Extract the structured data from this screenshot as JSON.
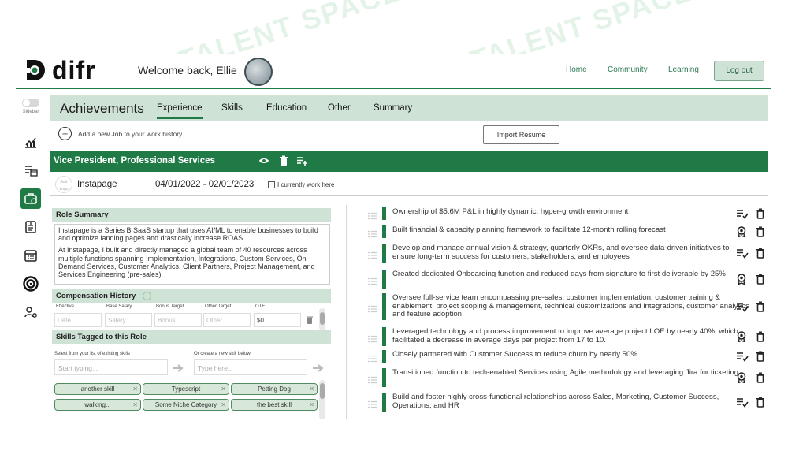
{
  "watermark": "AI TALENT SPACE",
  "header": {
    "logo_text": "difr",
    "welcome": "Welcome back, Ellie",
    "nav": [
      "Home",
      "Community",
      "Learning"
    ],
    "logout": "Log out"
  },
  "sidebar": {
    "toggle_label": "Sidebar",
    "icons": [
      "chart-icon",
      "list-calendar-icon",
      "briefcase-icon",
      "resume-icon",
      "calendar-icon",
      "target-icon",
      "user-settings-icon"
    ],
    "active_index": 2
  },
  "tabs": {
    "title": "Achievements",
    "items": [
      "Experience",
      "Skills",
      "Education",
      "Other",
      "Summary"
    ],
    "active": "Experience"
  },
  "add_job_text": "Add a new Job to your work history",
  "import_button": "Import Resume",
  "job": {
    "title": "Vice President, Professional Services",
    "add_logo": "Add Logo",
    "company": "Instapage",
    "dates": "04/01/2022 - 02/01/2023",
    "currently_work_here": "I currently work here"
  },
  "role_summary": {
    "header": "Role Summary",
    "paragraphs": [
      "Instapage is a Series B SaaS startup that uses AI/ML to enable businesses to build and optimize landing pages and drastically increase ROAS.",
      "At Instapage, I built and directly managed a global team of 40 resources across multiple functions spanning Implementation, Integrations, Custom Services, On-Demand Services, Customer Analytics, Client Partners, Project Management, and Services Engineering (pre-sales)"
    ]
  },
  "compensation": {
    "header": "Compensation History",
    "labels": [
      "Effective",
      "Base Salary",
      "Bonus Target",
      "Other Target",
      "OTE"
    ],
    "placeholders": [
      "Date",
      "Salary",
      "Bonus",
      "Other"
    ],
    "ote_value": "$0"
  },
  "skills": {
    "header": "Skills Tagged to this Role",
    "select_label": "Select from your list of existing skills",
    "create_label": "Or create a new skill below",
    "select_placeholder": "Start typing...",
    "create_placeholder": "Type here...",
    "chips": [
      "another skill",
      "Typescript",
      "Petting Dog",
      "walking...",
      "Some Niche Category",
      "the best skill"
    ]
  },
  "achievements": [
    {
      "text": "Ownership of $5.6M P&L in highly dynamic, hyper-growth environment",
      "icon": "checklist-icon"
    },
    {
      "text": "Built financial & capacity planning framework to facilitate 12-month rolling forecast",
      "icon": "award-icon"
    },
    {
      "text": "Develop and manage annual vision & strategy, quarterly OKRs, and oversee data-driven initiatives to ensure long-term success for customers, stakeholders, and employees",
      "icon": "checklist-icon"
    },
    {
      "text": "Created dedicated Onboarding function and reduced days from signature to first deliverable by 25%",
      "icon": "award-icon"
    },
    {
      "text": "Oversee full-service team encompassing pre-sales, customer implementation, customer training & enablement, project scoping & management, technical customizations and integrations, customer analytics and feature adoption",
      "icon": "checklist-icon"
    },
    {
      "text": "Leveraged technology and process improvement to improve average project LOE by nearly 40%, which facilitated a decrease in average days per project from 17 to 10.",
      "icon": "award-icon"
    },
    {
      "text": "Closely partnered with Customer Success to reduce churn by nearly 50%",
      "icon": "checklist-icon"
    },
    {
      "text": "Transitioned function to tech-enabled Services using Agile methodology and leveraging Jira for ticketing",
      "icon": "award-icon"
    },
    {
      "text": "Build and foster highly cross-functional relationships across Sales, Marketing, Customer Success, Operations, and HR",
      "icon": "checklist-icon"
    }
  ],
  "colors": {
    "brand_green": "#1f7a46",
    "light_green": "#cfe2d6"
  }
}
